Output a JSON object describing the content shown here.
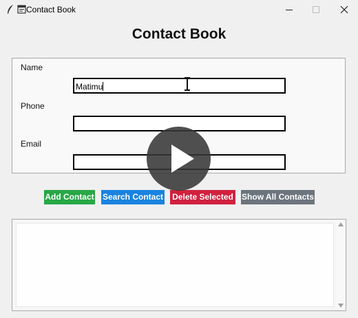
{
  "window": {
    "title": "Contact Book",
    "controls": [
      "minimize",
      "maximize",
      "close"
    ]
  },
  "heading": "Contact Book",
  "form": {
    "name_label": "Name",
    "name_value": "Matimu",
    "phone_label": "Phone",
    "phone_value": "",
    "email_label": "Email",
    "email_value": ""
  },
  "buttons": {
    "add": "Add Contact",
    "search": "Search Contact",
    "delete": "Delete Selected",
    "show_all": "Show All Contacts"
  },
  "colors": {
    "add": "#28a745",
    "search": "#1a83e0",
    "delete": "#d0213f",
    "show_all": "#6c757d"
  },
  "contacts_list": [],
  "icons": {
    "app": "feather-icon",
    "window": "app-window-icon",
    "overlay": "play-icon",
    "cursor": "ibeam-cursor-icon"
  }
}
